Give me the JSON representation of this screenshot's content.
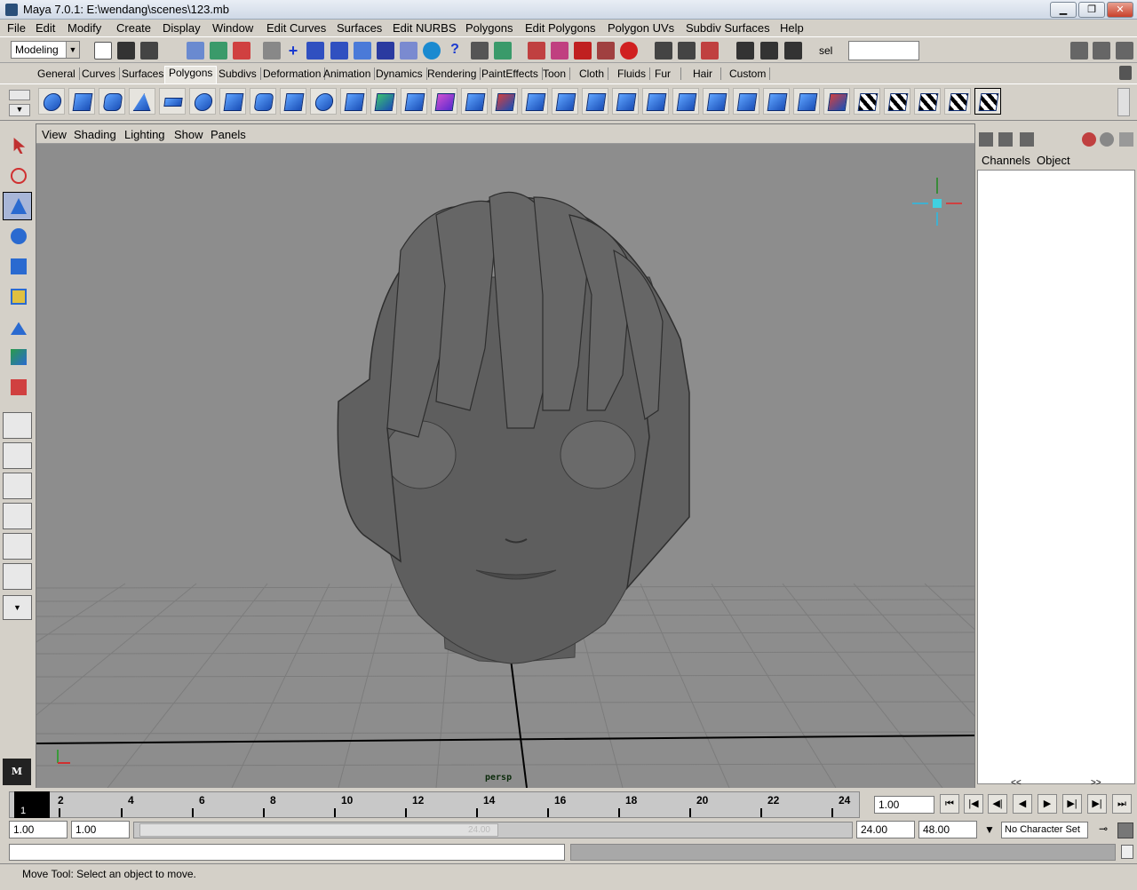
{
  "window": {
    "title": "Maya 7.0.1: E:\\wendang\\scenes\\123.mb",
    "minimize": "▁",
    "restore": "❐",
    "close": "✕"
  },
  "menubar": [
    "File",
    "Edit",
    "Modify",
    "Create",
    "Display",
    "Window",
    "Edit Curves",
    "Surfaces",
    "Edit NURBS",
    "Polygons",
    "Edit Polygons",
    "Polygon UVs",
    "Subdiv Surfaces",
    "Help"
  ],
  "toolbar": {
    "mode": "Modeling",
    "sel_label": "sel",
    "sel_value": ""
  },
  "shelf_tabs": [
    "General",
    "Curves",
    "Surfaces",
    "Polygons",
    "Subdivs",
    "Deformation",
    "Animation",
    "Dynamics",
    "Rendering",
    "PaintEffects",
    "Toon",
    "Cloth",
    "Fluids",
    "Fur",
    "Hair",
    "Custom"
  ],
  "shelf_active": "Polygons",
  "panel_menu": [
    "View",
    "Shading",
    "Lighting",
    "Show",
    "Panels"
  ],
  "viewport": {
    "camera": "persp"
  },
  "channel_box": {
    "tabs": [
      "Channels",
      "Object"
    ],
    "scroll_left": "<<",
    "scroll_right": ">>"
  },
  "timeline": {
    "current_frame": "1",
    "ticks": [
      "2",
      "4",
      "6",
      "8",
      "10",
      "12",
      "14",
      "16",
      "18",
      "20",
      "22",
      "24"
    ],
    "current_time": "1.00"
  },
  "range": {
    "start": "1.00",
    "playback_start": "1.00",
    "playback_end": "24.00",
    "end": "48.00",
    "slider_end_label": "24.00"
  },
  "character_set": "No Character Set",
  "command_line": "",
  "help_line": "Move Tool: Select an object to move.",
  "colors": {
    "viewport_bg": "#8d8d8d",
    "ui_bg": "#d4d0c8",
    "grid": "#7a7a7a",
    "model": "#5a5a5a"
  }
}
